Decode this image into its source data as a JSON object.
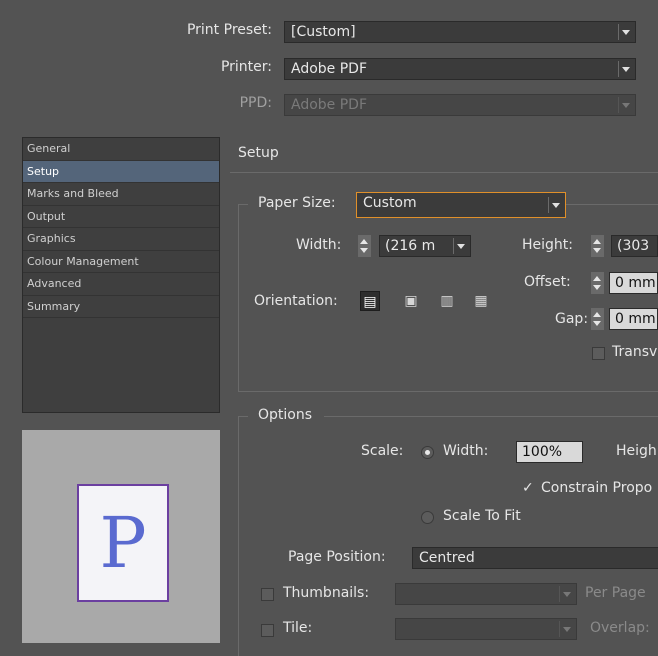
{
  "header": {
    "print_preset_label": "Print Preset:",
    "print_preset_value": "[Custom]",
    "printer_label": "Printer:",
    "printer_value": "Adobe PDF",
    "ppd_label": "PPD:",
    "ppd_value": "Adobe PDF"
  },
  "categories": [
    "General",
    "Setup",
    "Marks and Bleed",
    "Output",
    "Graphics",
    "Colour Management",
    "Advanced",
    "Summary"
  ],
  "selected_category": "Setup",
  "preview": {
    "letter": "P"
  },
  "setup": {
    "title": "Setup",
    "paper_size_label": "Paper Size:",
    "paper_size_value": "Custom",
    "width_label": "Width:",
    "width_value": "(216 m",
    "height_label": "Height:",
    "height_value": "(303",
    "offset_label": "Offset:",
    "offset_value": "0 mm",
    "gap_label": "Gap:",
    "gap_value": "0 mm",
    "orientation_label": "Orientation:",
    "transverse_label": "Transv"
  },
  "options": {
    "title": "Options",
    "scale_label": "Scale:",
    "width_radio_label": "Width:",
    "width_value": "100%",
    "height_label": "Heigh",
    "constrain_label": "Constrain Propo",
    "scale_to_fit_label": "Scale To Fit",
    "page_position_label": "Page Position:",
    "page_position_value": "Centred",
    "thumbnails_label": "Thumbnails:",
    "per_page_label": "Per Page",
    "tile_label": "Tile:",
    "overlap_label": "Overlap:"
  }
}
